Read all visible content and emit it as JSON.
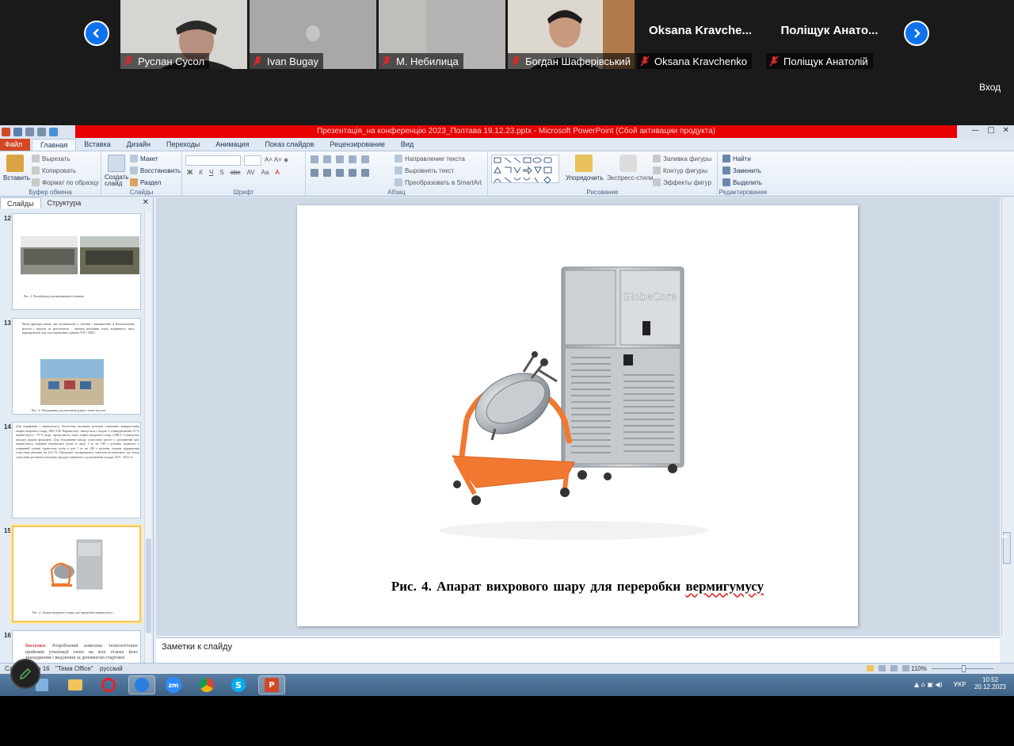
{
  "zoom": {
    "participants": [
      {
        "name": "Руслан Сусол",
        "display": "video"
      },
      {
        "name": "Ivan Bugay",
        "display": "video"
      },
      {
        "name": "M. Небилица",
        "display": "video"
      },
      {
        "name": "Богдан Шаферівський",
        "display": "video"
      },
      {
        "name": "Oksana Kravchenko",
        "display": "text",
        "header": "Oksana  Kravche..."
      },
      {
        "name": "Поліщук Анатолій",
        "display": "text",
        "header": "Поліщук Анато..."
      }
    ],
    "login_label": "Вход",
    "colors": {
      "nav": "#0e72ed",
      "mic_off": "#e02828"
    }
  },
  "ppt": {
    "title": "Презентація_на конференцію 2023_Полтава 19.12.23.pptx  -  Microsoft PowerPoint (Сбой активации продукта)",
    "tabs": [
      "Файл",
      "Главная",
      "Вставка",
      "Дизайн",
      "Переходы",
      "Анимация",
      "Показ слайдов",
      "Рецензирование",
      "Вид"
    ],
    "active_tab": "Главная",
    "ribbon": {
      "clipboard": {
        "paste": "Вставить",
        "cut": "Вырезать",
        "copy": "Копировать",
        "format": "Формат по образцу",
        "label": "Буфер обмена"
      },
      "slides": {
        "new": "Создать слайд",
        "layout": "Макет",
        "reset": "Восстановить",
        "section": "Раздел",
        "label": "Слайды"
      },
      "font": {
        "label": "Шрифт",
        "buttons": [
          "Ж",
          "К",
          "Ч",
          "S",
          "abc",
          "AV",
          "Aa",
          "A"
        ]
      },
      "paragraph": {
        "direction": "Направление текста",
        "align": "Выровнять текст",
        "smartart": "Преобразовать в SmartArt",
        "label": "Абзац"
      },
      "drawing": {
        "arrange": "Упорядочить",
        "styles": "Экспресс-стили",
        "fill": "Заливка фигуры",
        "outline": "Контур фигуры",
        "effects": "Эффекты фигур",
        "label": "Рисование"
      },
      "editing": {
        "find": "Найти",
        "replace": "Заменить",
        "select": "Выделить",
        "label": "Редактирование"
      }
    },
    "panel_tabs": [
      "Слайды",
      "Структура"
    ],
    "thumbnails": [
      {
        "num": "12",
        "caption": "Рис. 2. Вагонбудер для вермикомпостування"
      },
      {
        "num": "13",
        "text": "Якщо фракція тяжке, яка встановлена у таблиці і використана в Каховськомму регіоні і групові за результатом – значить речовини етапу вторинного типу, видокремлені для спостереження з рівнем ТОС-14001",
        "caption": "Рис. 3. Обладнання для внесення рідкого гною на поле"
      },
      {
        "num": "14",
        "text": "Для отримання з вермигумусу біологічно активних речовин плановано використання апарат вихрового шару АВС-100. Вермигумус змішується з водою в співвідношенні 25 % вермигумусу і 75 % води, пропускаємо через апарат вихрового шару (АВС) і отримуємо вихідну рідину фільтрата. Для обладнання вихіду гумусових кислот у розчиненій масі вермигумусу повинен переносити калію в пилу 1 кг на 100 л розчину, водночас у отриманій суміші сірчистому калія в дозі 1 кг на 100 л розчину спершу підвищення гумусових речовин на 22,0 %. Проведені експерименти показали встановлено, що вихід гумусових речовин в готовому продукті виявлено з досягненням складає 45,9 - 49,9 г/л"
      },
      {
        "num": "15",
        "caption": "Рис. 4. Апарат вихрового шару для переробки вермигумусу"
      },
      {
        "num": "16",
        "label": "Висновки.",
        "text": "Розроблений комплекс технологічних прийомів утилізації гною на всіх етапах його знаходження і виділення за допомогою стартової"
      }
    ],
    "slide": {
      "caption_main": "Рис. 4. Апарат  вихрового  шару для  переробки ",
      "caption_word": "вермигумусу",
      "brand": "GlobeCore"
    },
    "notes_placeholder": "Заметки к слайду",
    "status": {
      "slide": "Слайд 15 из 16",
      "theme": "\"Тема Office\"",
      "lang": "русский",
      "zoom": "110%"
    },
    "taskbar": {
      "lang": "УКР",
      "time": "10:52",
      "date": "20.12.2023"
    }
  }
}
